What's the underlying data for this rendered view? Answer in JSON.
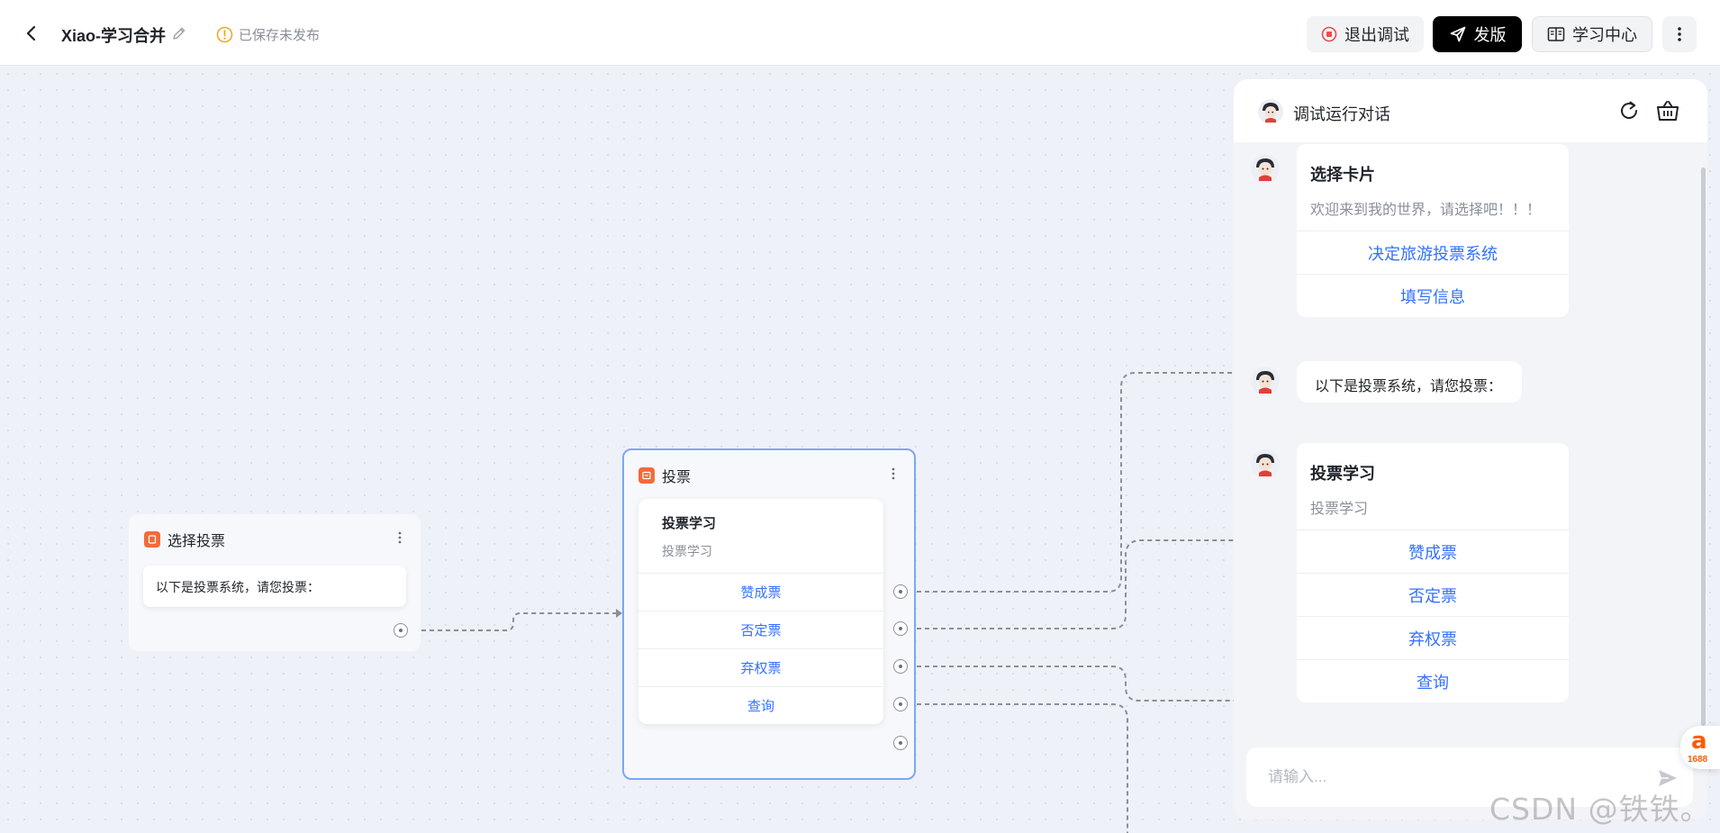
{
  "header": {
    "title": "Xiao-学习合并",
    "status": "已保存未发布",
    "exit_debug_label": "退出调试",
    "publish_label": "发版",
    "learning_center_label": "学习中心"
  },
  "canvas": {
    "select_node": {
      "title": "选择投票",
      "message": "以下是投票系统，请您投票："
    },
    "vote_node": {
      "title": "投票",
      "card_title": "投票学习",
      "card_subtitle": "投票学习",
      "options": [
        "赞成票",
        "否定票",
        "弃权票",
        "查询"
      ]
    }
  },
  "debug_panel": {
    "title": "调试运行对话",
    "messages": [
      {
        "type": "card",
        "title": "选择卡片",
        "subtitle": "欢迎来到我的世界，请选择吧！！！",
        "options": [
          "决定旅游投票系统",
          "填写信息"
        ]
      },
      {
        "type": "text",
        "text": "以下是投票系统，请您投票："
      },
      {
        "type": "card",
        "title": "投票学习",
        "subtitle": "投票学习",
        "options": [
          "赞成票",
          "否定票",
          "弃权票",
          "查询"
        ]
      }
    ],
    "input_placeholder": "请输入...",
    "input_value": ""
  },
  "floating_logo": {
    "glyph": "a",
    "number": "1688"
  },
  "watermark": "CSDN @铁铁。",
  "colors": {
    "accent_blue": "#3370ff",
    "node_badge": "#f26a3c",
    "selected_border": "#7ea6f5",
    "status_warning": "#f5a623",
    "exit_red": "#f04a4a"
  }
}
